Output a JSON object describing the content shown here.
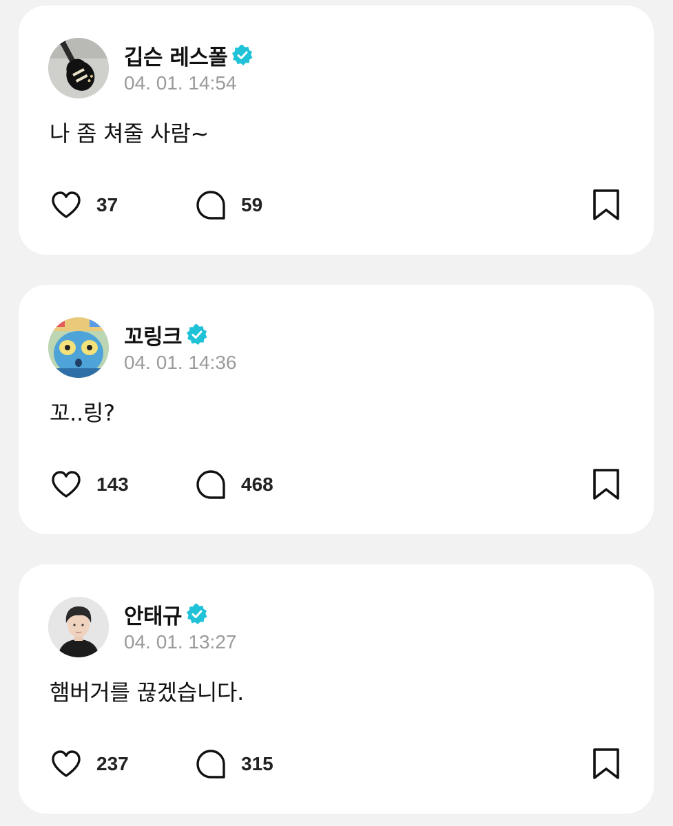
{
  "colors": {
    "background": "#f2f2f2",
    "card": "#ffffff",
    "verified_badge": "#1fc2d6",
    "timestamp": "#9a9a9a"
  },
  "posts": [
    {
      "author": "깁슨 레스폴",
      "verified": true,
      "avatar_icon": "guitar-avatar",
      "timestamp": "04. 01. 14:54",
      "text": "나 좀 쳐줄 사람~",
      "likes": "37",
      "comments": "59"
    },
    {
      "author": "꼬링크",
      "verified": true,
      "avatar_icon": "blue-creature-avatar",
      "timestamp": "04. 01. 14:36",
      "text": "꼬..링?",
      "likes": "143",
      "comments": "468"
    },
    {
      "author": "안태규",
      "verified": true,
      "avatar_icon": "person-avatar",
      "timestamp": "04. 01. 13:27",
      "text": "햄버거를 끊겠습니다.",
      "likes": "237",
      "comments": "315"
    }
  ],
  "icons": {
    "like": "heart-icon",
    "comment": "speech-bubble-icon",
    "bookmark": "bookmark-icon",
    "verified": "verified-badge-icon"
  }
}
